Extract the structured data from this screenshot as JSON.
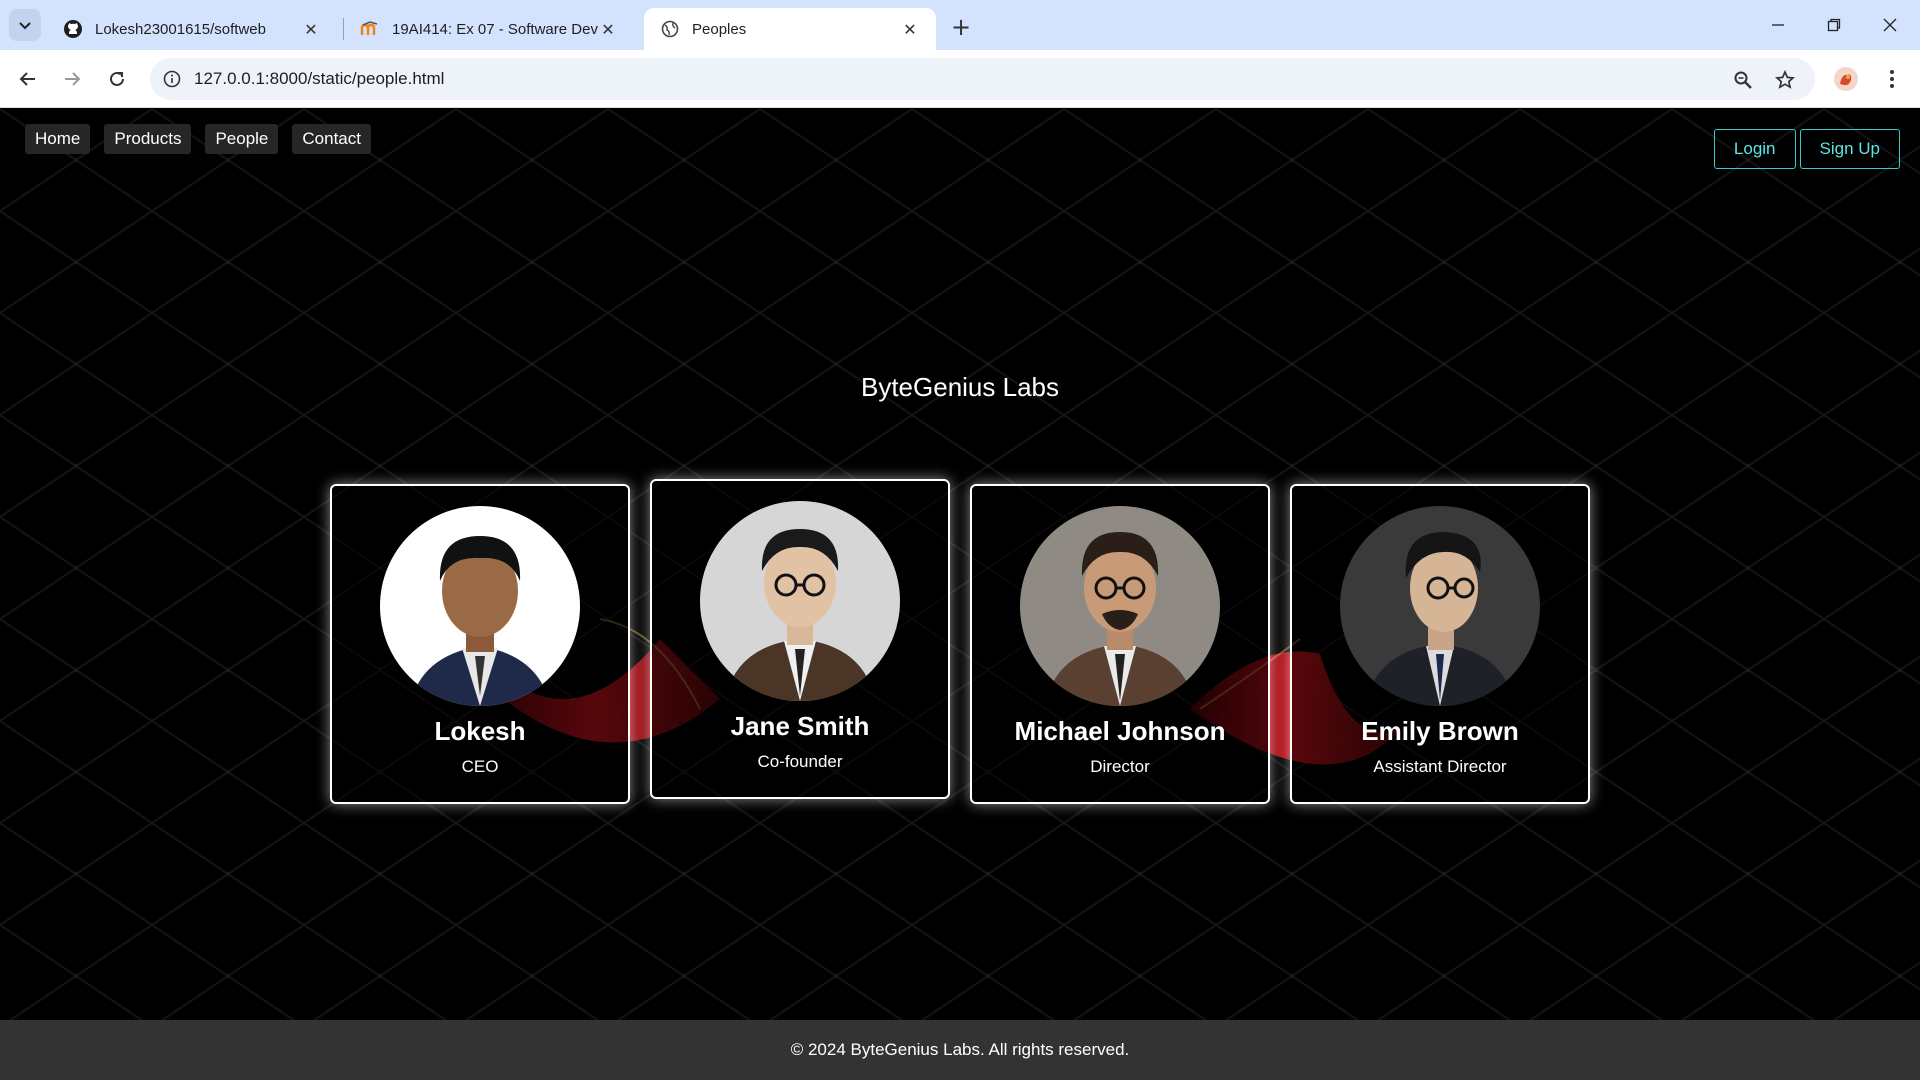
{
  "browser": {
    "tabs": [
      {
        "title": "Lokesh23001615/softweb",
        "icon": "github-icon",
        "active": false
      },
      {
        "title": "19AI414: Ex 07 - Software Deve",
        "icon": "moodle-icon",
        "active": false
      },
      {
        "title": "Peoples",
        "icon": "globe-icon",
        "active": true
      }
    ],
    "address": "127.0.0.1:8000/static/people.html"
  },
  "site": {
    "nav": [
      "Home",
      "Products",
      "People",
      "Contact"
    ],
    "login_label": "Login",
    "signup_label": "Sign Up",
    "brand": "ByteGenius Labs",
    "people": [
      {
        "name": "Lokesh",
        "role": "CEO"
      },
      {
        "name": "Jane Smith",
        "role": "Co-founder"
      },
      {
        "name": "Michael Johnson",
        "role": "Director"
      },
      {
        "name": "Emily Brown",
        "role": "Assistant Director"
      }
    ],
    "footer": "© 2024 ByteGenius Labs. All rights reserved.",
    "colors": {
      "accent": "#3cc9c9",
      "swoosh": "#d0101a",
      "card_border": "#ffffff"
    }
  }
}
